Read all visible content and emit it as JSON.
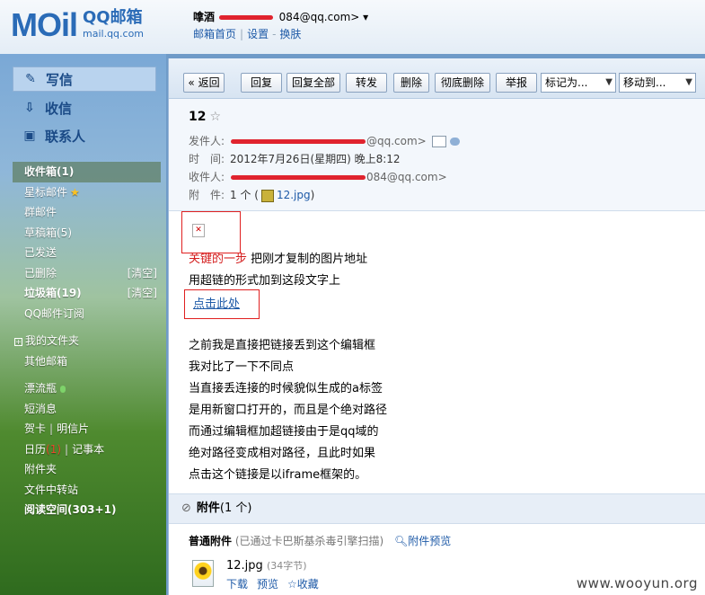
{
  "header": {
    "logo_mark": "MOil",
    "logo_title": "QQ邮箱",
    "logo_url": "mail.qq.com",
    "user_name": "嗱酒",
    "user_email_tail": "084@qq.com>",
    "dropdown_glyph": "▾",
    "links": [
      "邮箱首页",
      "设置",
      "换肤"
    ]
  },
  "sidebar": {
    "compose": [
      {
        "label": "写信",
        "icon": "pencil-icon"
      },
      {
        "label": "收信",
        "icon": "inbox-download-icon"
      },
      {
        "label": "联系人",
        "icon": "contact-card-icon"
      }
    ],
    "folders": [
      {
        "label": "收件箱(1)"
      },
      {
        "label": "星标邮件"
      },
      {
        "label": "群邮件"
      },
      {
        "label": "草稿箱(5)"
      },
      {
        "label": "已发送"
      },
      {
        "label": "已删除",
        "action": "[清空]"
      },
      {
        "label": "垃圾箱(19)",
        "action": "[清空]"
      },
      {
        "label": "QQ邮件订阅"
      },
      {
        "label": "我的文件夹"
      },
      {
        "label": "其他邮箱"
      },
      {
        "label": "漂流瓶"
      },
      {
        "label": "短消息"
      },
      {
        "label": "贺卡",
        "extra": "明信片"
      },
      {
        "label": "日历",
        "badge": "(1)",
        "extra": "记事本"
      },
      {
        "label": "附件夹"
      },
      {
        "label": "文件中转站"
      },
      {
        "label": "阅读空间(303+1)"
      }
    ]
  },
  "toolbar": {
    "back": "« 返回",
    "reply": "回复",
    "reply_all": "回复全部",
    "forward": "转发",
    "delete": "删除",
    "delete_forever": "彻底删除",
    "report": "举报",
    "mark_as": "标记为...",
    "move_to": "移动到..."
  },
  "message": {
    "subject": "12",
    "from_label": "发件人:",
    "from_value": "@qq.com>",
    "time_label": "时　间:",
    "time_value": "2012年7月26日(星期四) 晚上8:12",
    "to_label": "收件人:",
    "to_value": "084@qq.com>",
    "attach_label": "附　件:",
    "attach_count": "1 个 (",
    "attach_name": "12.jpg",
    "attach_close": ")"
  },
  "body": {
    "line1_red": "关键的一步",
    "line1_rest": " 把刚才复制的图片地址",
    "line2": "用超链的形式加到这段文字上",
    "link_text": "点击此处",
    "para": [
      "之前我是直接把链接丢到这个编辑框",
      "我对比了一下不同点",
      "当直接丢连接的时候貌似生成的a标签",
      "是用新窗口打开的，而且是个绝对路径",
      "而通过编辑框加超链接由于是qq域的",
      "绝对路径变成相对路径，且此时如果",
      "点击这个链接是以iframe框架的。"
    ]
  },
  "attachments": {
    "head": "附件",
    "head_count": "(1 个)",
    "normal_label": "普通附件",
    "scan_note": "(已通过卡巴斯基杀毒引擎扫描)",
    "preview_all": "附件预览",
    "file_name": "12.jpg",
    "file_size": "(34字节)",
    "actions": [
      "下载",
      "预览",
      "收藏"
    ]
  },
  "watermark": "www.wooyun.org"
}
